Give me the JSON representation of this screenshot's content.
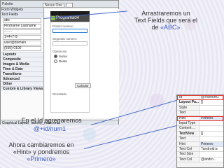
{
  "ide": {
    "tabs": [
      "Palette"
    ],
    "toolbar": {
      "device_label": "Nexus One",
      "theme_label": "..."
    },
    "palette": {
      "sections": [
        "Form Widgets",
        "Text Fields"
      ],
      "field_value": "abc",
      "items": [
        "Firstname Lastname",
        "........",
        "1+4+7-9",
        "user@domain",
        "(555)-0100"
      ],
      "lower_sections": [
        "Layouts",
        "Composite",
        "Images & Media",
        "Time & Date",
        "Transitions",
        "Advanced",
        "Other",
        "Custom & Library Views"
      ]
    },
    "bottom_tabs": [
      "Graphical Layout",
      "activity_main.xml"
    ]
  },
  "phone": {
    "app_title": "Programa04",
    "label_primer": "Primer numero",
    "label_segundo": "Segundo numero",
    "label_operacion": "Operacion",
    "radio_suma": "Suma",
    "radio_resta": "Resta",
    "calc_button": "Calcular",
    "result_label": "Resultado"
  },
  "callouts": {
    "top_line1": "Arrastraremos un",
    "top_line2": "Text Fields que será el",
    "top_line3": "de",
    "top_accent": "«ABC»",
    "mid_line1": "En el Id agregaremos",
    "mid_accent": "@+id/num1",
    "bottom_line1": "Ahora cambiaremos en",
    "bottom_line2": "«Hint» y pondremos",
    "bottom_accent": "«Primero»"
  },
  "properties": {
    "rows": [
      {
        "k": "Id",
        "v": "@+id/num1"
      },
      {
        "k": "Layout Pa...",
        "v": "[]"
      },
      {
        "k": "Style",
        "v": ""
      },
      {
        "k": "Text",
        "v": ""
      },
      {
        "k": "Hint",
        "v": "Primero"
      },
      {
        "k": "Input Type",
        "v": ""
      },
      {
        "k": "Content ...",
        "v": ""
      },
      {
        "k": "TextView",
        "v": "[]"
      },
      {
        "k": "Text",
        "v": ""
      },
      {
        "k": "Hint",
        "v": "Primero"
      },
      {
        "k": "Text Col",
        "v": "?android:a"
      },
      {
        "k": "Text Size",
        "v": ""
      },
      {
        "k": "Text Col",
        "v": "@andro..."
      }
    ]
  },
  "colors": {
    "accent": "#3b5cc4",
    "highlight": "#e53935"
  }
}
